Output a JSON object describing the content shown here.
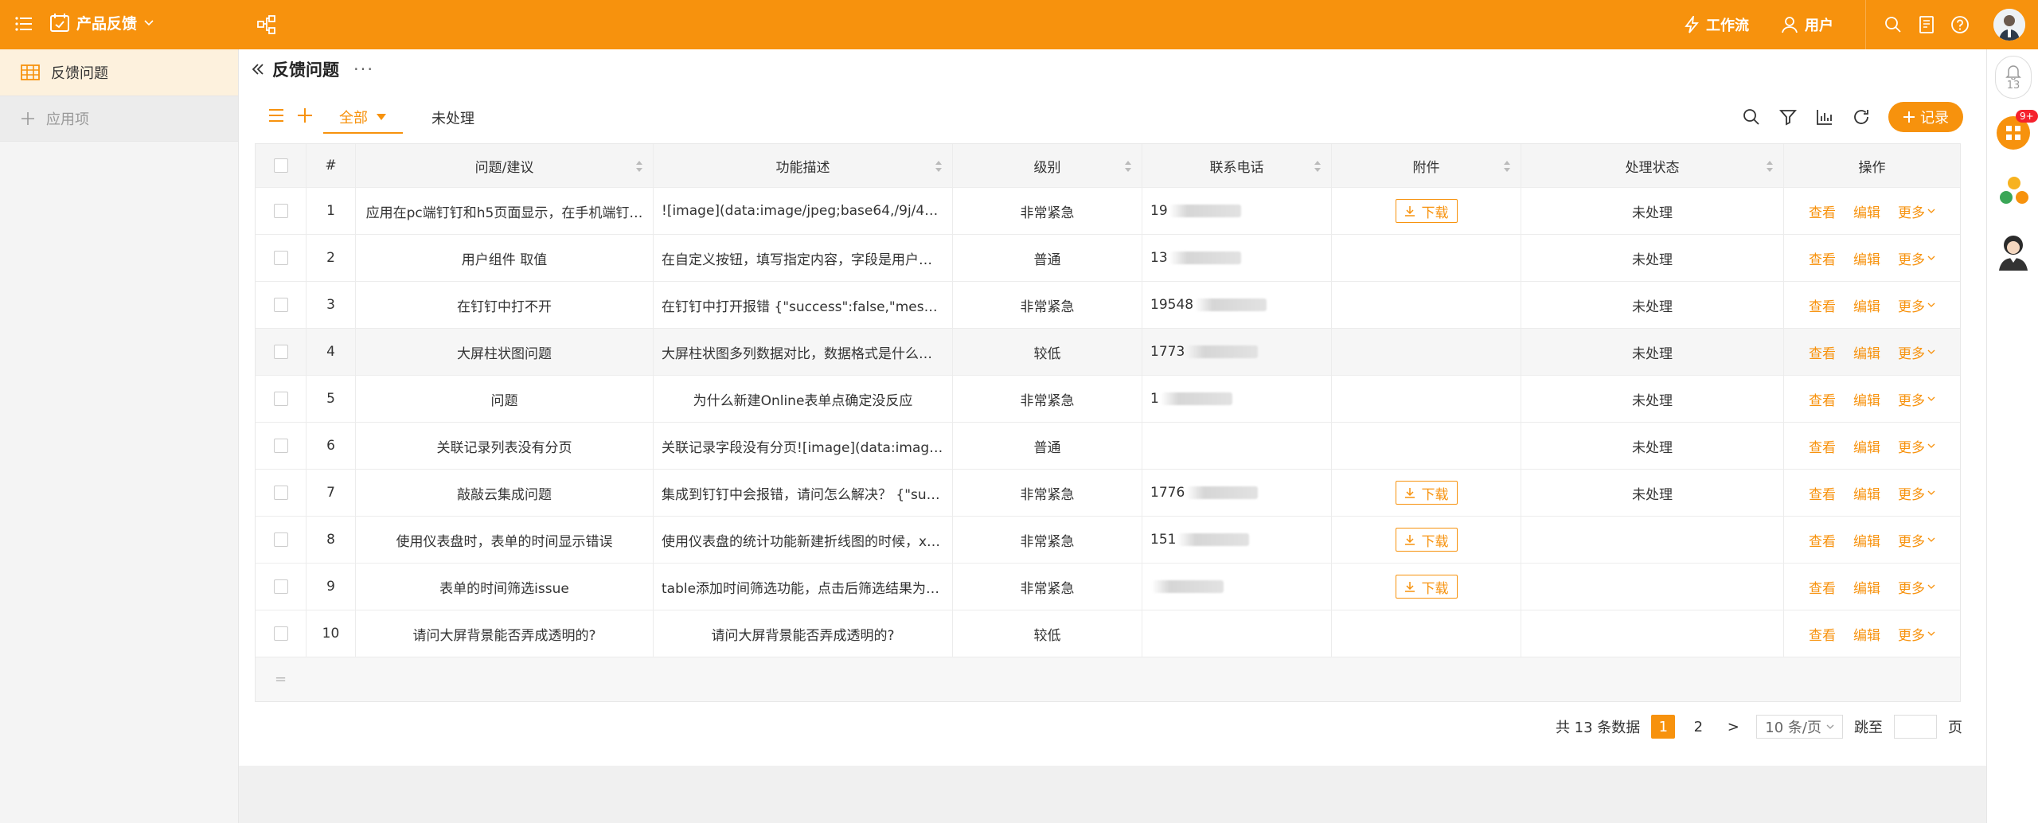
{
  "app": {
    "title": "产品反馈"
  },
  "topbar": {
    "workflow_label": "工作流",
    "user_label": "用户"
  },
  "sidebar": {
    "items": [
      {
        "label": "反馈问题"
      }
    ],
    "add_label": "应用项"
  },
  "page": {
    "title": "反馈问题",
    "more": "···"
  },
  "tabs": {
    "all": "全部",
    "pending": "未处理"
  },
  "toolbar": {
    "add_record": "记录"
  },
  "table": {
    "columns": [
      "#",
      "问题/建议",
      "功能描述",
      "级别",
      "联系电话",
      "附件",
      "处理状态",
      "操作"
    ],
    "rows": [
      {
        "no": "1",
        "q": "应用在pc端钉钉和h5页面显示，在手机端钉…",
        "desc": "![image](data:image/jpeg;base64,/9j/4AAQS…",
        "level": "非常紧急",
        "phone": "19",
        "attach": "下载",
        "status": "未处理"
      },
      {
        "no": "2",
        "q": "用户组件 取值",
        "desc": "在自定义按钮，填写指定内容，字段是用户…",
        "level": "普通",
        "phone": "13",
        "attach": "",
        "status": "未处理"
      },
      {
        "no": "3",
        "q": "在钉钉中打不开",
        "desc": "在钉钉中打开报错 {\"success\":false,\"message…",
        "level": "非常紧急",
        "phone": "19548",
        "attach": "",
        "status": "未处理"
      },
      {
        "no": "4",
        "q": "大屏柱状图问题",
        "desc": "大屏柱状图多列数据对比，数据格式是什么…",
        "level": "较低",
        "phone": "1773",
        "attach": "",
        "status": "未处理"
      },
      {
        "no": "5",
        "q": "问题",
        "desc": "为什么新建Online表单点确定没反应",
        "level": "非常紧急",
        "phone": "1",
        "attach": "",
        "status": "未处理"
      },
      {
        "no": "6",
        "q": "关联记录列表没有分页",
        "desc": "关联记录字段没有分页![image](data:image/…",
        "level": "普通",
        "phone": "",
        "attach": "",
        "status": "未处理"
      },
      {
        "no": "7",
        "q": "敲敲云集成问题",
        "desc": "集成到钉钉中会报错，请问怎么解决？ {\"suc…",
        "level": "非常紧急",
        "phone": "1776",
        "attach": "下载",
        "status": "未处理"
      },
      {
        "no": "8",
        "q": "使用仪表盘时，表单的时间显示错误",
        "desc": "使用仪表盘的统计功能新建折线图的时候，x…",
        "level": "非常紧急",
        "phone": "151",
        "attach": "下载",
        "status": ""
      },
      {
        "no": "9",
        "q": "表单的时间筛选issue",
        "desc": "table添加时间筛选功能，点击后筛选结果为…",
        "level": "非常紧急",
        "phone": "",
        "attach": "下载",
        "status": ""
      },
      {
        "no": "10",
        "q": "请问大屏背景能否弄成透明的?",
        "desc": "请问大屏背景能否弄成透明的?",
        "level": "较低",
        "phone": "",
        "attach": "",
        "status": ""
      }
    ],
    "ops": {
      "view": "查看",
      "edit": "编辑",
      "more": "更多"
    },
    "footer_mark": "="
  },
  "pagination": {
    "total": "共 13 条数据",
    "pages": [
      "1",
      "2"
    ],
    "current": "1",
    "next": ">",
    "size": "10 条/页",
    "jump": "跳至",
    "page_unit": "页"
  },
  "rail": {
    "notice_count": "13",
    "app_badge": "9+"
  },
  "colors": {
    "brand": "#f7920d",
    "badge": "#f5222d"
  }
}
